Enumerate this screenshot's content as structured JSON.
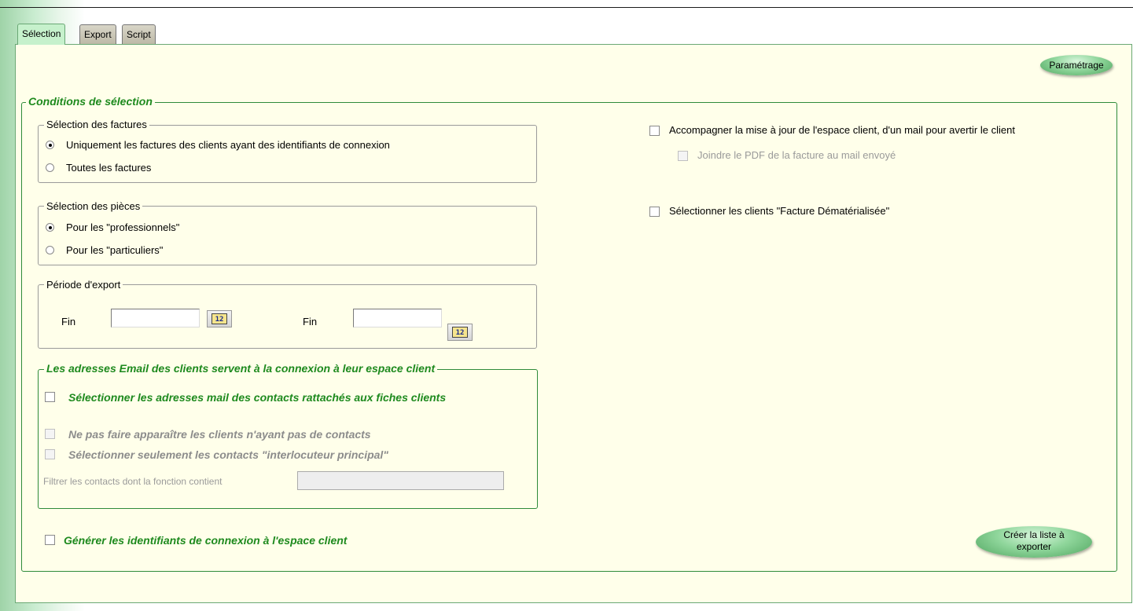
{
  "tabs": [
    {
      "label": "Sélection",
      "active": true
    },
    {
      "label": "Export",
      "active": false
    },
    {
      "label": "Script",
      "active": false
    }
  ],
  "buttons": {
    "parametrage": "Paramétrage",
    "creer_line1": "Créer la liste à",
    "creer_line2": "exporter"
  },
  "conditions": {
    "title": "Conditions de sélection",
    "factures": {
      "title": "Sélection des factures",
      "options": [
        {
          "label": "Uniquement les factures des clients ayant des identifiants de connexion",
          "selected": true
        },
        {
          "label": "Toutes les factures",
          "selected": false
        }
      ]
    },
    "pieces": {
      "title": "Sélection des pièces",
      "options": [
        {
          "label": "Pour les \"professionnels\"",
          "selected": true
        },
        {
          "label": "Pour les \"particuliers\"",
          "selected": false
        }
      ]
    },
    "periode": {
      "title": "Période d'export",
      "start_label": "Fin",
      "end_label": "Fin",
      "start_value": "",
      "end_value": "",
      "calendar_icon": "calendar-icon",
      "calendar_glyph": "12"
    },
    "emails": {
      "title": "Les adresses Email des clients servent à la connexion à leur espace client",
      "select_contacts": "Sélectionner les adresses mail des contacts rattachés aux fiches clients",
      "hide_no_contacts": "Ne pas faire apparaître les clients n'ayant pas de contacts",
      "main_contact_only": "Sélectionner seulement les contacts \"interlocuteur principal\"",
      "filter_label": "Filtrer les contacts dont la fonction contient",
      "filter_value": ""
    },
    "generate_ids": "Générer les identifiants de connexion à l'espace client",
    "mail_update": "Accompagner la mise à jour de l'espace client, d'un mail pour avertir le client",
    "attach_pdf": "Joindre le PDF de la facture au mail envoyé",
    "dematerialisee": "Sélectionner les clients \"Facture Dématérialisée\""
  },
  "colors": {
    "panel_bg": "#ffffea",
    "accent_green": "#1e8a1e",
    "active_tab": "#c6f1cc"
  }
}
